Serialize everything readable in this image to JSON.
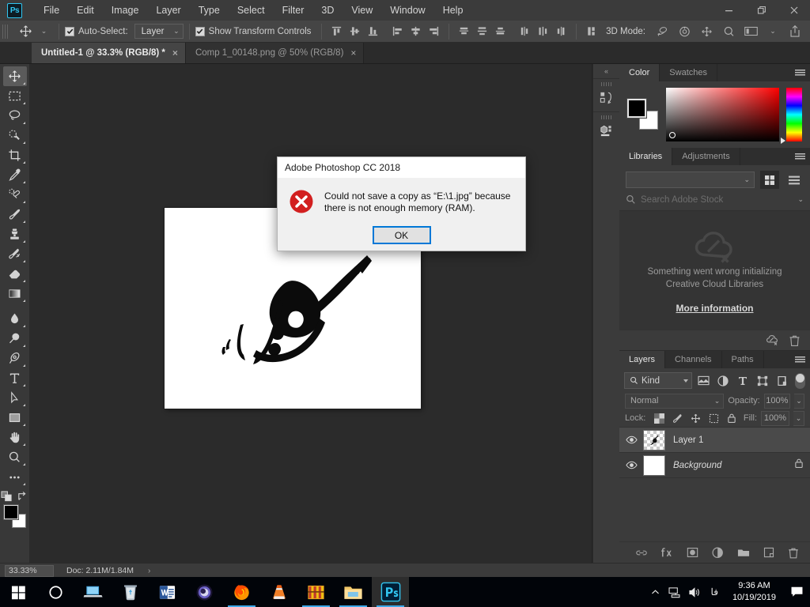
{
  "app": {
    "logo": "Ps",
    "menus": [
      "File",
      "Edit",
      "Image",
      "Layer",
      "Type",
      "Select",
      "Filter",
      "3D",
      "View",
      "Window",
      "Help"
    ],
    "window_controls": {
      "minimize": "minimize-icon",
      "restore": "restore-icon",
      "close": "close-icon"
    }
  },
  "options_bar": {
    "tool_icon": "move-tool-icon",
    "auto_select_label": "Auto-Select:",
    "auto_select_checked": true,
    "auto_select_value": "Layer",
    "show_transform_label": "Show Transform Controls",
    "show_transform_checked": true,
    "align_icons": [
      "align-top-edges-icon",
      "align-vertical-centers-icon",
      "align-bottom-edges-icon",
      "align-left-edges-icon",
      "align-horizontal-centers-icon",
      "align-right-edges-icon"
    ],
    "distribute_icons": [
      "distribute-top-edges-icon",
      "distribute-vertical-centers-icon",
      "distribute-bottom-edges-icon",
      "distribute-left-edges-icon",
      "distribute-horizontal-centers-icon",
      "distribute-right-edges-icon"
    ],
    "more_align_icon": "align-more-options-icon",
    "mode_3d_label": "3D Mode:",
    "mode_3d_icons": [
      "orbit-3d-icon",
      "roll-3d-icon",
      "pan-3d-icon",
      "zoom-3d-icon"
    ],
    "workspace_icon": "workspace-switcher-icon",
    "share_icon": "share-icon"
  },
  "tabs": [
    {
      "label": "Untitled-1 @ 33.3% (RGB/8) *",
      "active": true,
      "close": "×"
    },
    {
      "label": "Comp 1_00148.png @ 50% (RGB/8)",
      "active": false,
      "close": "×"
    }
  ],
  "toolbar": {
    "tools": [
      {
        "name": "move-tool",
        "active": true
      },
      {
        "name": "rectangular-marquee-tool",
        "active": false
      },
      {
        "name": "lasso-tool",
        "active": false
      },
      {
        "name": "quick-selection-tool",
        "active": false
      },
      {
        "name": "crop-tool",
        "active": false
      },
      {
        "name": "eyedropper-tool",
        "active": false
      },
      {
        "name": "spot-healing-brush-tool",
        "active": false
      },
      {
        "name": "brush-tool",
        "active": false
      },
      {
        "name": "clone-stamp-tool",
        "active": false
      },
      {
        "name": "history-brush-tool",
        "active": false
      },
      {
        "name": "eraser-tool",
        "active": false
      },
      {
        "name": "gradient-tool",
        "active": false
      },
      {
        "name": "blur-tool",
        "active": false
      },
      {
        "name": "dodge-tool",
        "active": false
      },
      {
        "name": "pen-tool",
        "active": false
      },
      {
        "name": "horizontal-type-tool",
        "active": false
      },
      {
        "name": "path-selection-tool",
        "active": false
      },
      {
        "name": "rectangle-tool",
        "active": false
      },
      {
        "name": "hand-tool",
        "active": false
      },
      {
        "name": "zoom-tool",
        "active": false
      },
      {
        "name": "edit-toolbar-tool",
        "active": false
      }
    ],
    "foreground_color": "#000000",
    "background_color": "#ffffff"
  },
  "canvas": {
    "artwork_alt": "persian-calligraphy-goftar-ma",
    "background_color": "#ffffff"
  },
  "status_bar": {
    "zoom": "33.33%",
    "doc_info": "Doc: 2.11M/1.84M",
    "expand_arrow": "›"
  },
  "dock": {
    "collapse_icon": "collapse-panels-icon",
    "items": [
      "history-panel-icon",
      "3d-panel-icon"
    ]
  },
  "color_panel": {
    "tabs": [
      {
        "label": "Color",
        "active": true
      },
      {
        "label": "Swatches",
        "active": false
      }
    ],
    "foreground_color": "#000000",
    "background_color": "#ffffff",
    "spectrum_color": "#ff0000"
  },
  "libraries_panel": {
    "tabs": [
      {
        "label": "Libraries",
        "active": true
      },
      {
        "label": "Adjustments",
        "active": false
      }
    ],
    "library_select_value": "",
    "search_placeholder": "Search Adobe Stock",
    "error_line1": "Something went wrong initializing",
    "error_line2": "Creative Cloud Libraries",
    "more_info_link": "More information",
    "footer_icons": [
      "sync-error-icon",
      "delete-icon"
    ]
  },
  "layers_panel": {
    "tabs": [
      {
        "label": "Layers",
        "active": true
      },
      {
        "label": "Channels",
        "active": false
      },
      {
        "label": "Paths",
        "active": false
      }
    ],
    "filter_kind_label": "Kind",
    "filter_icons": [
      "filter-pixel-icon",
      "filter-adjustment-icon",
      "filter-type-icon",
      "filter-shape-icon",
      "filter-smart-object-icon"
    ],
    "blend_mode": "Normal",
    "opacity_label": "Opacity:",
    "opacity_value": "100%",
    "lock_label": "Lock:",
    "lock_icons": [
      "lock-transparent-pixels-icon",
      "lock-image-pixels-icon",
      "lock-position-icon",
      "lock-artboard-icon",
      "lock-all-icon"
    ],
    "fill_label": "Fill:",
    "fill_value": "100%",
    "layers": [
      {
        "name": "Layer 1",
        "visible": true,
        "selected": true,
        "italic": false,
        "locked": false,
        "thumb": "checker"
      },
      {
        "name": "Background",
        "visible": true,
        "selected": false,
        "italic": true,
        "locked": true,
        "thumb": "white"
      }
    ],
    "footer_icons": [
      "link-layers-icon",
      "layer-style-fx-icon",
      "add-layer-mask-icon",
      "new-adjustment-layer-icon",
      "new-group-icon",
      "new-layer-icon",
      "delete-layer-icon"
    ]
  },
  "dialog": {
    "title": "Adobe Photoshop CC 2018",
    "icon": "error-icon",
    "message_line1": "Could not save a copy as “E:\\1.jpg” because",
    "message_line2": "there is not enough memory (RAM).",
    "ok_label": "OK",
    "accent_color": "#0078d7",
    "error_color": "#d21f1f"
  },
  "taskbar": {
    "items": [
      {
        "name": "start-button",
        "running": false,
        "active": false
      },
      {
        "name": "cortana-search-icon",
        "running": false,
        "active": false
      },
      {
        "name": "task-view-icon",
        "running": false,
        "active": false
      },
      {
        "name": "recycle-bin-icon",
        "running": false,
        "active": false
      },
      {
        "name": "microsoft-word-icon",
        "running": false,
        "active": false
      },
      {
        "name": "cinema-4d-icon",
        "running": false,
        "active": false
      },
      {
        "name": "firefox-icon",
        "running": true,
        "active": false
      },
      {
        "name": "vlc-media-player-icon",
        "running": false,
        "active": false
      },
      {
        "name": "media-app-icon",
        "running": true,
        "active": false
      },
      {
        "name": "file-explorer-icon",
        "running": true,
        "active": false
      },
      {
        "name": "photoshop-icon",
        "running": true,
        "active": true
      }
    ],
    "tray": {
      "show_hidden_icon": "chevron-up-icon",
      "network_icon": "network-icon",
      "volume_icon": "volume-icon",
      "language": "فا",
      "time": "9:36 AM",
      "date": "10/19/2019",
      "action_center_icon": "action-center-icon"
    }
  }
}
